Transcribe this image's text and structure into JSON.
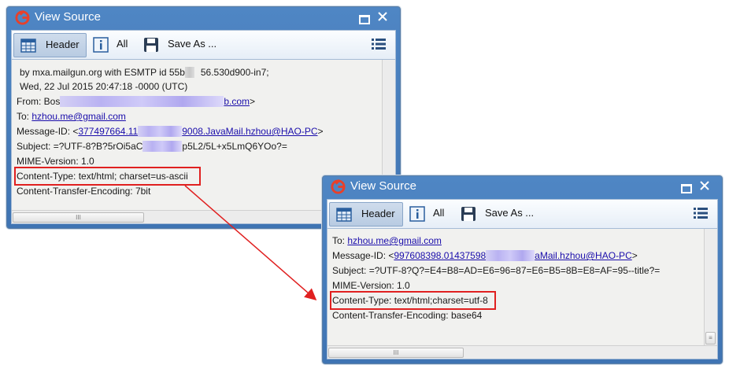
{
  "window1": {
    "title": "View Source",
    "toolbar": {
      "header_label": "Header",
      "all_label": "All",
      "save_label": "Save As ..."
    },
    "lines": {
      "received": "by mxa.mailgun.org with ESMTP id 55b",
      "received_tail": "56.530d900-in7;",
      "date": "Wed, 22 Jul 2015 20:47:18 -0000 (UTC)",
      "from_prefix": "From: Bos",
      "from_link": "b.com",
      "from_suffix": ">",
      "to_prefix": "To: ",
      "to_link": "hzhou.me@gmail.com",
      "msgid_prefix": "Message-ID: <",
      "msgid_link_a": "377497664.11",
      "msgid_link_b": "9008.JavaMail.hzhou@HAO-PC",
      "msgid_suffix": ">",
      "subject_a": "Subject: =?UTF-8?B?5rOi5aC",
      "subject_b": "p5L2/5L+x5LmQ6YOo?=",
      "mime": "MIME-Version: 1.0",
      "content_type": "Content-Type: text/html; charset=us-ascii",
      "encoding": "Content-Transfer-Encoding: 7bit"
    },
    "hscroll_grip": "III"
  },
  "window2": {
    "title": "View Source",
    "toolbar": {
      "header_label": "Header",
      "all_label": "All",
      "save_label": "Save As ..."
    },
    "lines": {
      "to_prefix": "To: ",
      "to_link": "hzhou.me@gmail.com",
      "msgid_prefix": "Message-ID: <",
      "msgid_link_a": "997608398.01437598",
      "msgid_link_b": "aMail.hzhou@HAO-PC",
      "msgid_suffix": ">",
      "subject": "Subject: =?UTF-8?Q?=E4=B8=AD=E6=96=87=E6=B5=8B=E8=AF=95--title?=",
      "mime": "MIME-Version: 1.0",
      "content_type": "Content-Type: text/html;charset=utf-8",
      "encoding": "Content-Transfer-Encoding: base64"
    },
    "hscroll_grip": "III",
    "vscroll_grip": "≡"
  },
  "colors": {
    "highlight": "#e02020",
    "arrow": "#e02020",
    "titlebar": "#4a80bf",
    "link": "#1a0dab"
  }
}
